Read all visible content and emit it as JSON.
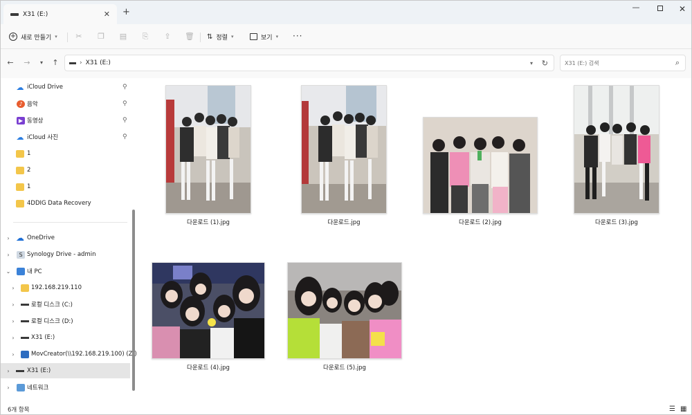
{
  "window": {
    "tab_title": "X31 (E:)",
    "new_tab_symbol": "+",
    "close_tab_symbol": "✕",
    "minimize_symbol": "—",
    "close_symbol": "✕"
  },
  "toolbar": {
    "new_label": "새로 만들기",
    "sort_label": "정렬",
    "view_label": "보기",
    "more_label": "···"
  },
  "address": {
    "crumb": "X31 (E:)",
    "search_placeholder": "X31 (E:) 검색"
  },
  "sidebar": {
    "quick_access": [
      {
        "label": "iCloud Drive",
        "icon": "icloud-drive-icon"
      },
      {
        "label": "음악",
        "icon": "music-icon"
      },
      {
        "label": "동영상",
        "icon": "video-icon"
      },
      {
        "label": "iCloud 사진",
        "icon": "icloud-photos-icon"
      },
      {
        "label": "1",
        "icon": "folder-icon"
      },
      {
        "label": "2",
        "icon": "folder-icon"
      },
      {
        "label": "1",
        "icon": "folder-icon"
      },
      {
        "label": "4DDIG Data Recovery",
        "icon": "folder-icon"
      }
    ],
    "tree": [
      {
        "label": "OneDrive",
        "icon": "onedrive-icon"
      },
      {
        "label": "Synology Drive - admin",
        "icon": "synology-icon"
      },
      {
        "label": "내 PC",
        "icon": "pc-icon"
      },
      {
        "label": "192.168.219.110",
        "icon": "network-location-icon"
      },
      {
        "label": "로컬 디스크 (C:)",
        "icon": "drive-icon"
      },
      {
        "label": "로컬 디스크 (D:)",
        "icon": "drive-icon"
      },
      {
        "label": "X31 (E:)",
        "icon": "drive-icon"
      },
      {
        "label": "MovCreator(\\\\192.168.219.100) (Z:)",
        "icon": "network-drive-icon"
      },
      {
        "label": "X31 (E:)",
        "icon": "drive-icon"
      },
      {
        "label": "네트워크",
        "icon": "network-icon"
      }
    ]
  },
  "files": [
    {
      "name": "다운로드 (1).jpg"
    },
    {
      "name": "다운로드.jpg"
    },
    {
      "name": "다운로드 (2).jpg"
    },
    {
      "name": "다운로드 (3).jpg"
    },
    {
      "name": "다운로드 (4).jpg"
    },
    {
      "name": "다운로드 (5).jpg"
    }
  ],
  "status": {
    "item_count": "6개 항목"
  },
  "colors": {
    "accent": "#2a7de1",
    "folder": "#f3c64a",
    "selection": "#e5e5e5"
  }
}
